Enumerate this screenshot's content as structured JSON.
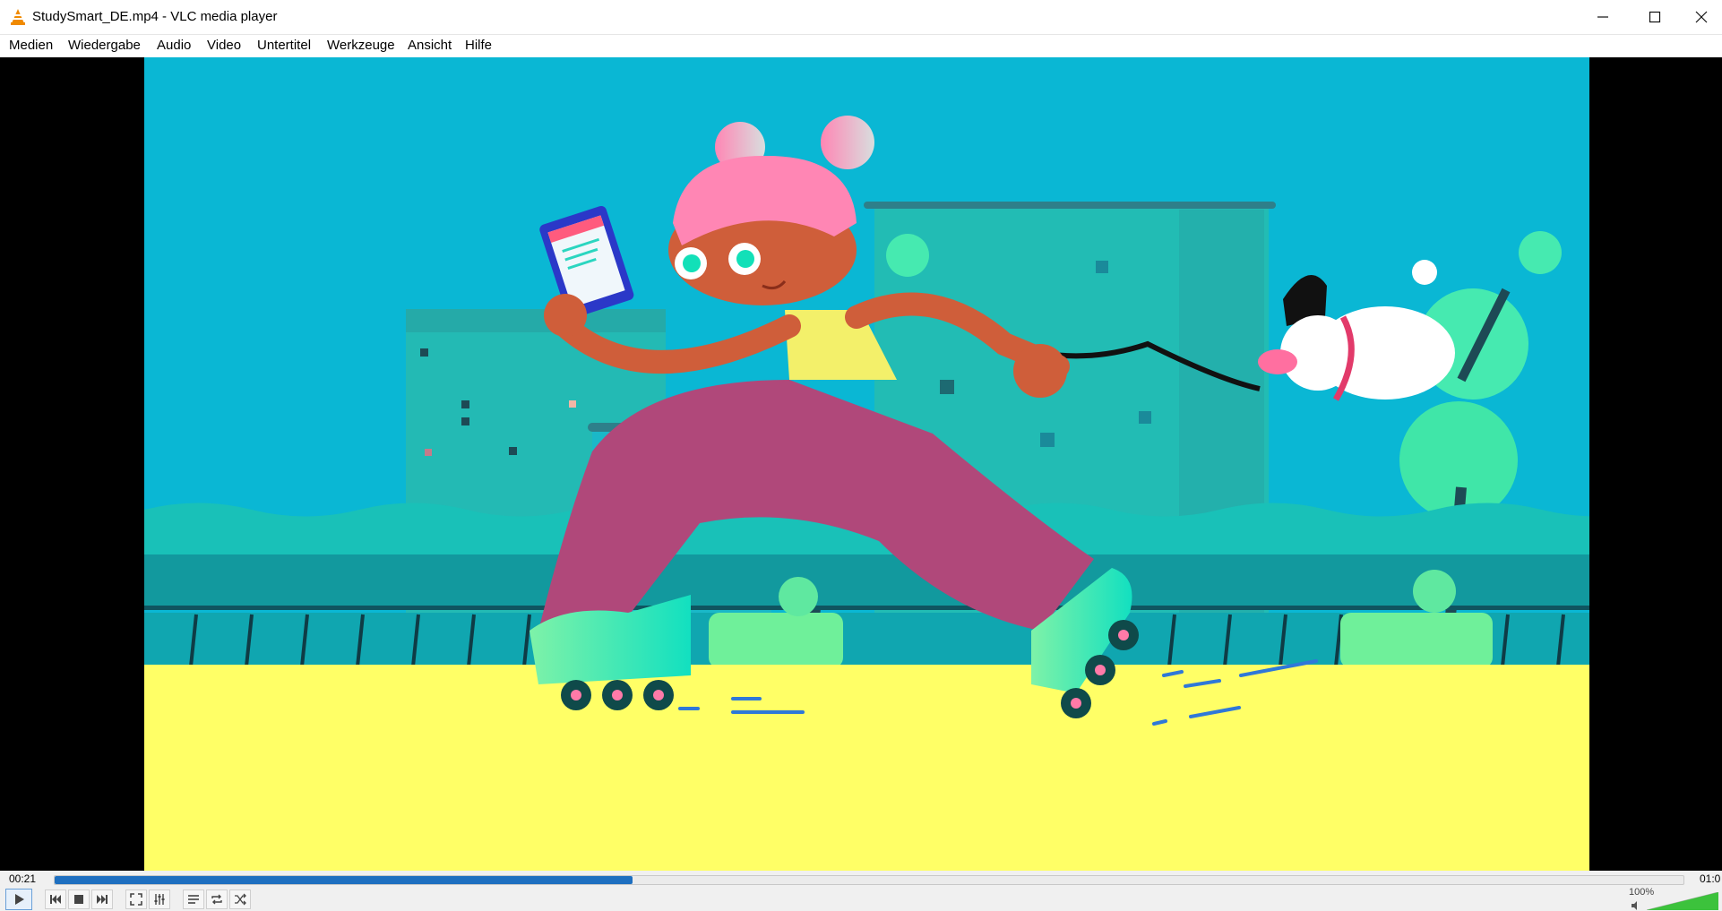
{
  "window": {
    "title": "StudySmart_DE.mp4 - VLC media player",
    "icon": "vlc-cone-icon",
    "controls": [
      "minimize-icon",
      "maximize-icon",
      "close-icon"
    ]
  },
  "menu": {
    "items": [
      "Medien",
      "Wiedergabe",
      "Audio",
      "Video",
      "Untertitel",
      "Werkzeuge",
      "Ansicht",
      "Hilfe"
    ]
  },
  "playback": {
    "elapsed": "00:21",
    "total": "01:0",
    "progress": 0.355
  },
  "volume": {
    "label": "100%",
    "level": 1.0
  },
  "toolbar": {
    "buttons": [
      "play-icon",
      "previous-icon",
      "stop-icon",
      "next-icon",
      "fullscreen-icon",
      "extended-settings-icon",
      "playlist-icon",
      "loop-icon",
      "shuffle-icon"
    ]
  },
  "colors": {
    "accent": "#1e6fc0",
    "sky": "#0ab7d4",
    "ground": "#ffff66",
    "pants": "#b0487a",
    "skates": "#1ee6b4",
    "hair": "#ff86b4"
  }
}
